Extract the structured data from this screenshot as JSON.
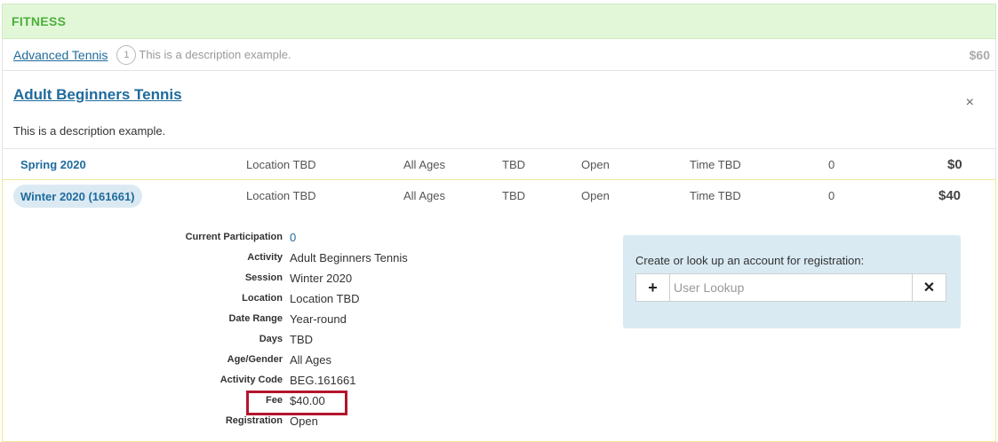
{
  "category": {
    "title": "FITNESS"
  },
  "activity": {
    "name": "Advanced Tennis",
    "count": "1",
    "description": "This is a description example.",
    "price": "$60"
  },
  "detail": {
    "title": "Adult Beginners Tennis",
    "close": "×",
    "description": "This is a description example."
  },
  "sessions": [
    {
      "name": "Spring 2020",
      "location": "Location TBD",
      "ages": "All Ages",
      "days": "TBD",
      "status": "Open",
      "time": "Time TBD",
      "count": "0",
      "price": "$0"
    },
    {
      "name": "Winter 2020 (161661)",
      "location": "Location TBD",
      "ages": "All Ages",
      "days": "TBD",
      "status": "Open",
      "time": "Time TBD",
      "count": "0",
      "price": "$40"
    }
  ],
  "info": {
    "participation": {
      "label": "Current Participation",
      "value": "0"
    },
    "activity": {
      "label": "Activity",
      "value": "Adult Beginners Tennis"
    },
    "session": {
      "label": "Session",
      "value": "Winter 2020"
    },
    "location": {
      "label": "Location",
      "value": "Location TBD"
    },
    "date_range": {
      "label": "Date Range",
      "value": "Year-round"
    },
    "days": {
      "label": "Days",
      "value": "TBD"
    },
    "age_gender": {
      "label": "Age/Gender",
      "value": "All Ages"
    },
    "activity_code": {
      "label": "Activity Code",
      "value": "BEG.161661"
    },
    "fee": {
      "label": "Fee",
      "value": "$40.00"
    },
    "registration": {
      "label": "Registration",
      "value": "Open"
    }
  },
  "register": {
    "prompt": "Create or look up an account for registration:",
    "placeholder": "User Lookup",
    "add_icon": "+",
    "clear_icon": "✕"
  },
  "colors": {
    "accent": "#1f6b9c",
    "category_bg": "#e2f7d8",
    "category_text": "#4caf3b",
    "highlight": "#b3152e"
  }
}
